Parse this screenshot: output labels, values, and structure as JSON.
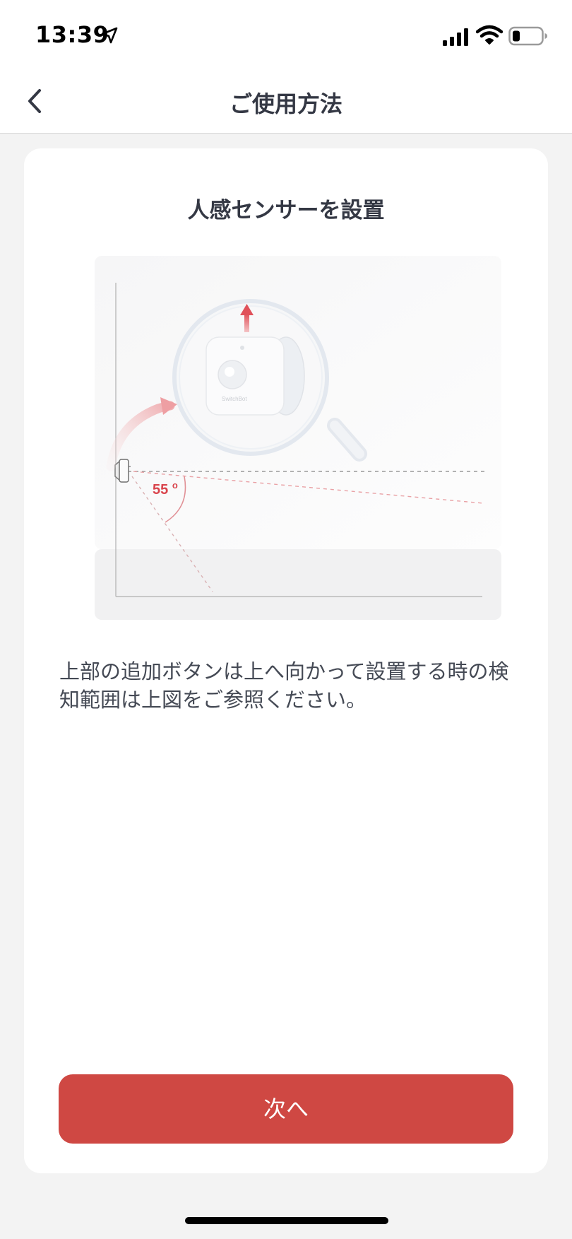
{
  "status_bar": {
    "time": "13:39"
  },
  "nav": {
    "title": "ご使用方法"
  },
  "card": {
    "title": "人感センサーを設置",
    "illustration": {
      "angle_label": "55",
      "angle_unit": "o",
      "device_label": "SwitchBot"
    },
    "description": "上部の追加ボタンは上へ向かって設置する時の検知範囲は上図をご参照ください。",
    "next_button": "次へ"
  },
  "colors": {
    "accent": "#cf4843",
    "background": "#f3f3f3",
    "card": "#ffffff",
    "text": "#343844"
  },
  "icons": [
    "location-arrow-icon",
    "signal-icon",
    "wifi-icon",
    "battery-icon",
    "back-chevron-icon"
  ]
}
